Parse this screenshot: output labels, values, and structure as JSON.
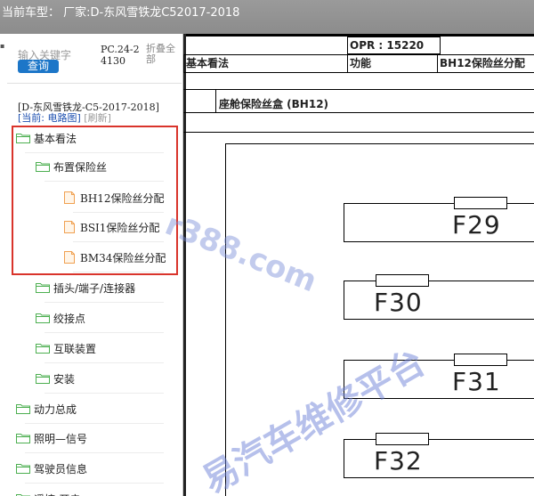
{
  "title_bar": {
    "text": "当前车型： 厂家:D-东风雪铁龙C52017-2018"
  },
  "search": {
    "placeholder": "输入关键字",
    "query_label": "查询"
  },
  "pc_code": "PC.24-24130",
  "collapse_all": "折叠全部",
  "vehicle_line": "[D-东风雪铁龙-C5-2017-2018]",
  "current": {
    "prefix": "[当前: 电路图]",
    "refresh": "[刷新]"
  },
  "tree": [
    {
      "label": "基本看法",
      "type": "folder"
    },
    {
      "label": "布置保险丝",
      "type": "folder"
    },
    {
      "label": "BH12保险丝分配",
      "type": "doc"
    },
    {
      "label": "BSI1保险丝分配",
      "type": "doc"
    },
    {
      "label": "BM34保险丝分配",
      "type": "doc"
    },
    {
      "label": "插头/端子/连接器",
      "type": "folder"
    },
    {
      "label": "绞接点",
      "type": "folder"
    },
    {
      "label": "互联装置",
      "type": "folder"
    },
    {
      "label": "安装",
      "type": "folder"
    },
    {
      "label": "动力总成",
      "type": "folder"
    },
    {
      "label": "照明—信号",
      "type": "folder"
    },
    {
      "label": "驾驶员信息",
      "type": "folder"
    },
    {
      "label": "遥控-开启",
      "type": "folder"
    }
  ],
  "doc": {
    "opr": "OPR : 15220",
    "section_left": "基本看法",
    "section_mid": "功能",
    "section_right": "BH12保险丝分配",
    "subsection": "座舱保险丝盒 (BH12)",
    "fuses": [
      "F29",
      "F30",
      "F31",
      "F32"
    ]
  },
  "watermarks": [
    "r388.com",
    "易汽车维修平台"
  ],
  "colors": {
    "highlight": "#d9342b",
    "button": "#1c76c8",
    "title_bar": "#8c8c8c",
    "folder": "#4caf50",
    "doc_icon": "#f0a050"
  }
}
